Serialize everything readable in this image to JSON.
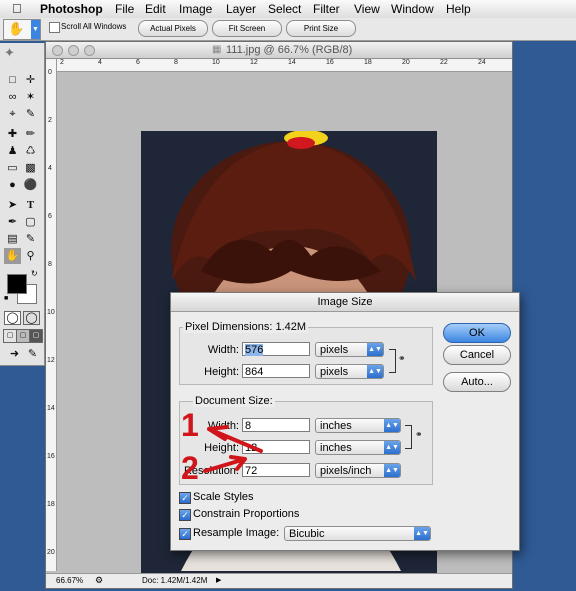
{
  "menubar": {
    "app_name": "Photoshop",
    "items": [
      "File",
      "Edit",
      "Image",
      "Layer",
      "Select",
      "Filter",
      "View",
      "Window",
      "Help"
    ]
  },
  "options_bar": {
    "scroll_all_label": "Scroll All Windows",
    "actual_pixels": "Actual Pixels",
    "fit_screen": "Fit Screen",
    "print_size": "Print Size"
  },
  "document": {
    "title": "111.jpg @ 66.7% (RGB/8)",
    "ruler_top": [
      "2",
      "4",
      "6",
      "8",
      "10",
      "12",
      "14",
      "16",
      "18",
      "20",
      "22",
      "24"
    ],
    "ruler_left": [
      "0",
      "2",
      "4",
      "6",
      "8",
      "10",
      "12",
      "14",
      "16",
      "18",
      "20"
    ],
    "zoom": "66.67%",
    "doc_info": "Doc: 1.42M/1.42M"
  },
  "dialog": {
    "title": "Image Size",
    "pixel_dimensions_label": "Pixel Dimensions:",
    "pixel_dimensions_size": "1.42M",
    "width_label": "Width:",
    "width_value": "576",
    "width_unit": "pixels",
    "height_label": "Height:",
    "height_value": "864",
    "height_unit": "pixels",
    "document_size_label": "Document Size:",
    "doc_width_label": "Width:",
    "doc_width_value": "8",
    "doc_width_unit": "inches",
    "doc_height_label": "Height:",
    "doc_height_value": "12",
    "doc_height_unit": "inches",
    "resolution_label": "Resolution:",
    "resolution_value": "72",
    "resolution_unit": "pixels/inch",
    "scale_styles": "Scale Styles",
    "constrain_proportions": "Constrain Proportions",
    "resample_label": "Resample Image:",
    "resample_value": "Bicubic",
    "ok": "OK",
    "cancel": "Cancel",
    "auto": "Auto..."
  },
  "annotations": {
    "one": "1",
    "two": "2"
  },
  "colors": {
    "desktop": "#2f5a94",
    "accent_blue": "#3c86e2",
    "annotation_red": "#d0161b"
  }
}
